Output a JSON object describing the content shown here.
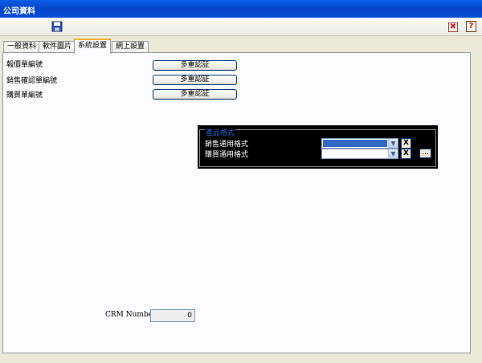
{
  "window": {
    "title": "公司資料"
  },
  "toolbar": {
    "save_icon": "save-icon",
    "close_icon": "close-icon",
    "help_icon": "help-icon",
    "close_glyph": "✖",
    "help_glyph": "?"
  },
  "tabs": [
    {
      "label": "一般資料",
      "active": false
    },
    {
      "label": "軟件圖片",
      "active": false
    },
    {
      "label": "系統設置",
      "active": true
    },
    {
      "label": "網上設置",
      "active": false
    }
  ],
  "numbering": [
    {
      "label": "報價單編號",
      "button": "多重認証"
    },
    {
      "label": "銷售確認單編號",
      "button": "多重認証"
    },
    {
      "label": "購買單編號",
      "button": "多重認証"
    }
  ],
  "product_format": {
    "legend": "產品格式",
    "rows": [
      {
        "label": "銷售通用格式",
        "value": "",
        "x_label": "X"
      },
      {
        "label": "購買通用格式",
        "value": "",
        "x_label": "X"
      }
    ],
    "more_label": "..."
  },
  "crm": {
    "label": "CRM Number :",
    "value": "0"
  },
  "colors": {
    "titlebar": "#0a4fd8",
    "selection": "#316ac5",
    "tab_accent": "#f8b330"
  }
}
